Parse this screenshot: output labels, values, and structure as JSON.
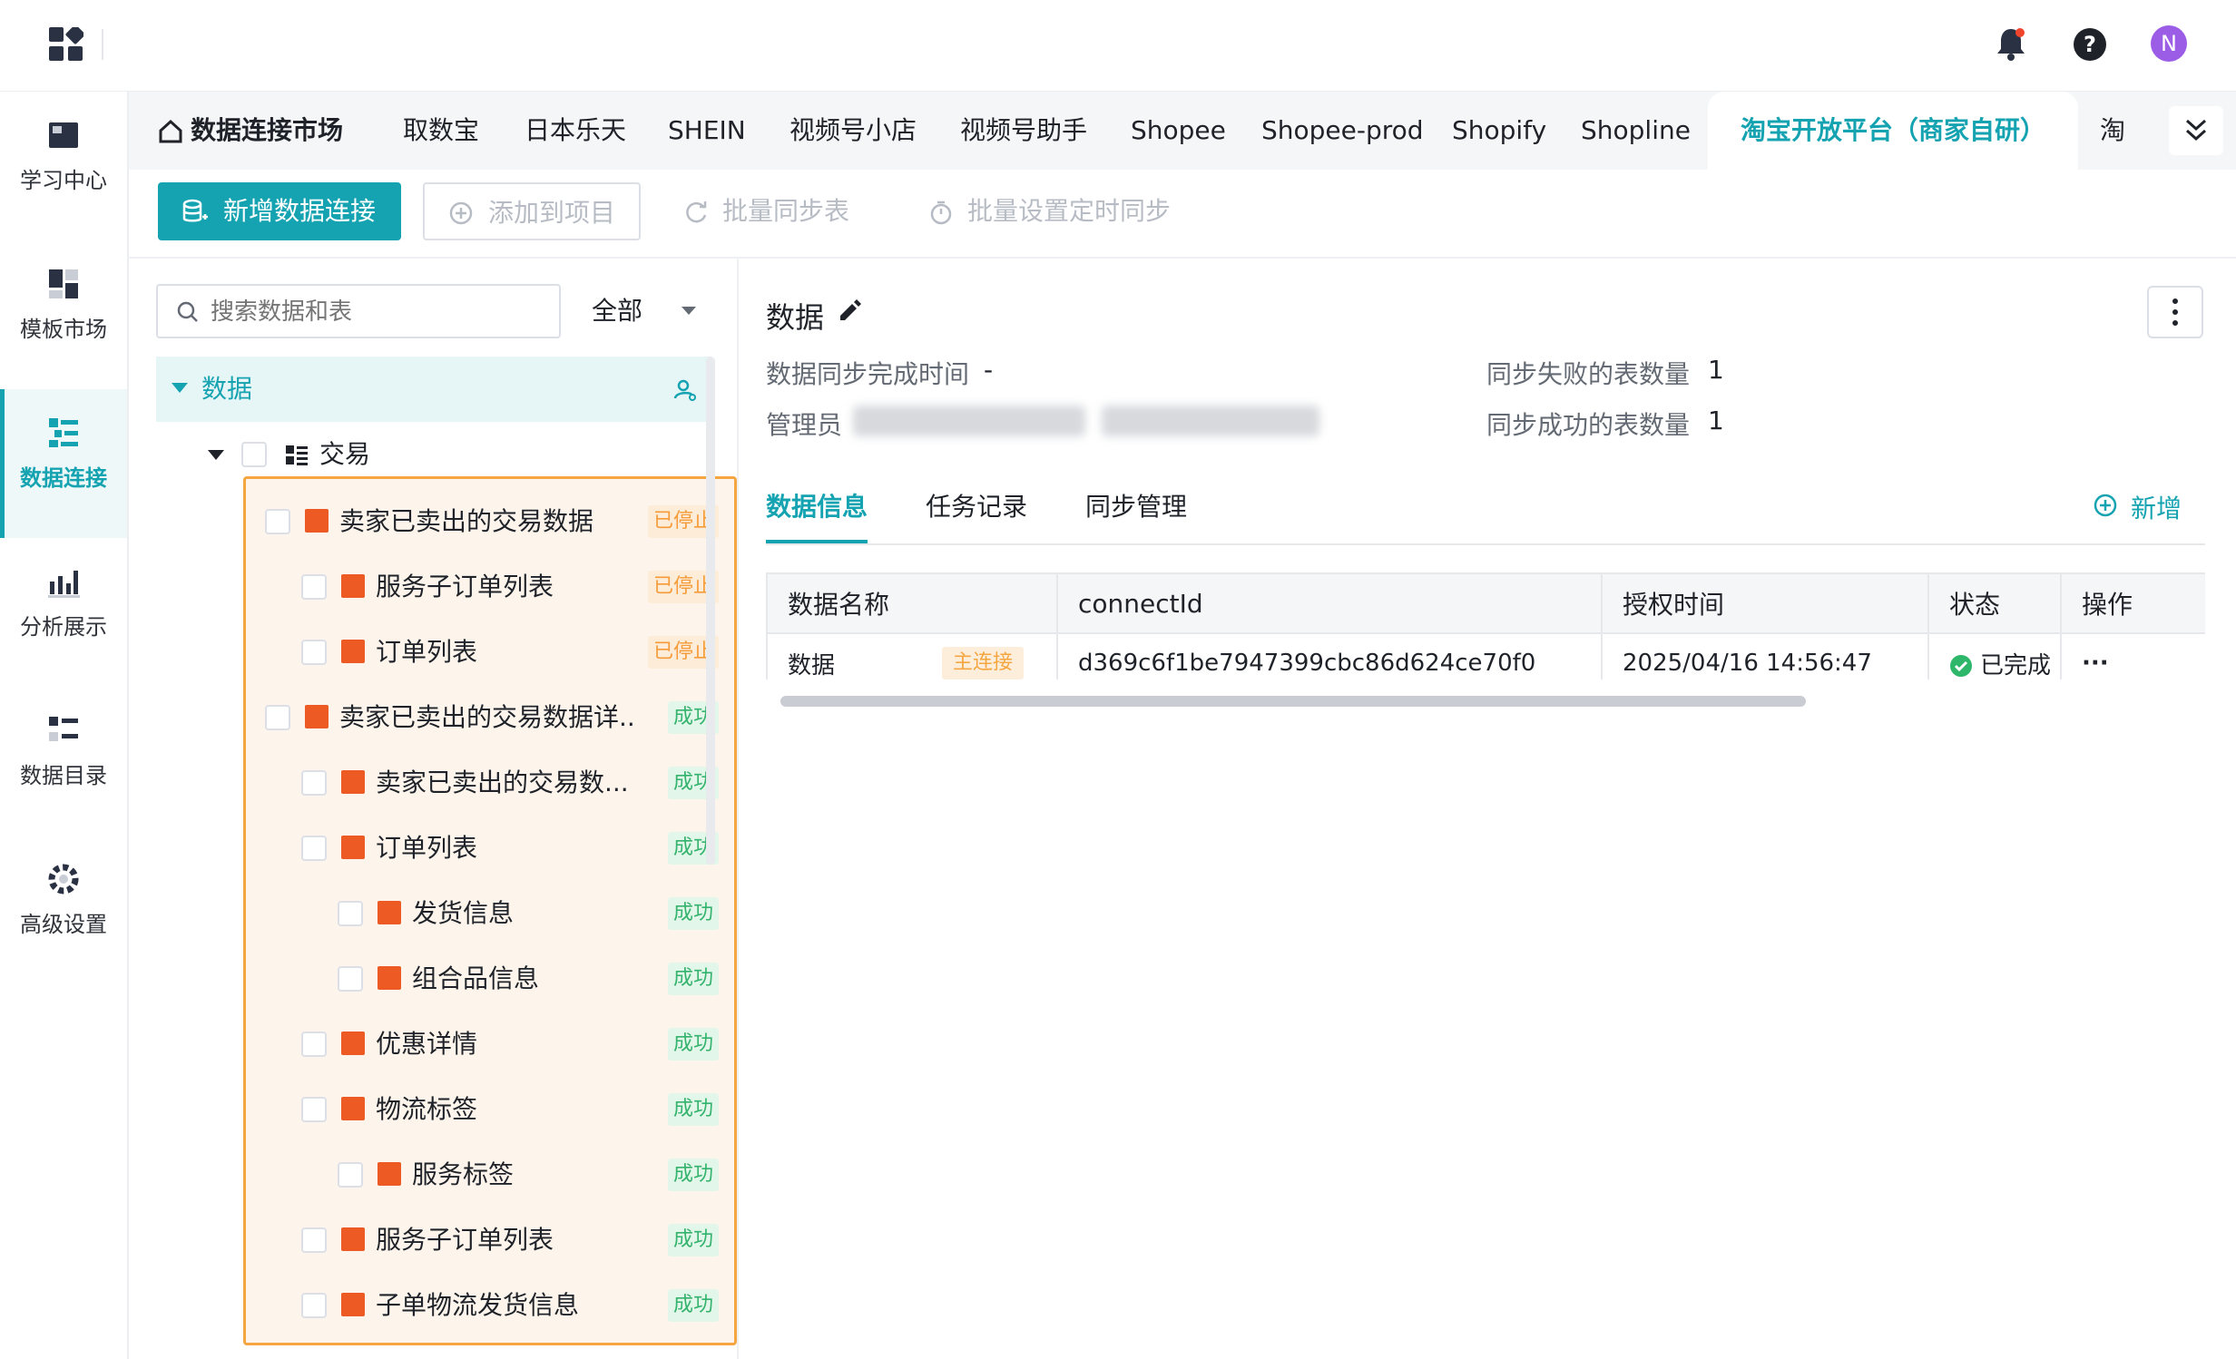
{
  "header": {
    "notification_icon": "bell-icon",
    "help_icon": "question-icon",
    "avatar_letter": "N",
    "avatar_color": "#9b5de5"
  },
  "rail": {
    "items": [
      {
        "label": "学习中心",
        "icon": "book-icon"
      },
      {
        "label": "模板市场",
        "icon": "template-icon"
      },
      {
        "label": "数据连接",
        "icon": "data-connect-icon"
      },
      {
        "label": "分析展示",
        "icon": "chart-icon"
      },
      {
        "label": "数据目录",
        "icon": "catalog-icon"
      },
      {
        "label": "高级设置",
        "icon": "gear-icon"
      }
    ]
  },
  "tabs": {
    "home_label": "数据连接市场",
    "items": [
      "取数宝",
      "日本乐天",
      "SHEIN",
      "视频号小店",
      "视频号助手",
      "Shopee",
      "Shopee-prod",
      "Shopify",
      "Shopline",
      "淘宝开放平台（商家自研）",
      "淘"
    ]
  },
  "toolbar": {
    "add_connection": "新增数据连接",
    "add_to_project": "添加到项目",
    "batch_sync": "批量同步表",
    "batch_schedule": "批量设置定时同步"
  },
  "tree": {
    "search_placeholder": "搜索数据和表",
    "filter_value": "全部",
    "root_label": "数据",
    "group_label": "交易",
    "items": [
      {
        "label": "卖家已卖出的交易数据",
        "status": "已停止",
        "ok": false
      },
      {
        "label": "服务子订单列表",
        "status": "已停止",
        "ok": false
      },
      {
        "label": "订单列表",
        "status": "已停止",
        "ok": false
      },
      {
        "label": "卖家已卖出的交易数据详...",
        "status": "成功",
        "ok": true
      },
      {
        "label": "卖家已卖出的交易数...",
        "status": "成功",
        "ok": true
      },
      {
        "label": "订单列表",
        "status": "成功",
        "ok": true
      },
      {
        "label": "发货信息",
        "status": "成功",
        "ok": true
      },
      {
        "label": "组合品信息",
        "status": "成功",
        "ok": true
      },
      {
        "label": "优惠详情",
        "status": "成功",
        "ok": true
      },
      {
        "label": "物流标签",
        "status": "成功",
        "ok": true
      },
      {
        "label": "服务标签",
        "status": "成功",
        "ok": true
      },
      {
        "label": "服务子订单列表",
        "status": "成功",
        "ok": true
      },
      {
        "label": "子单物流发货信息",
        "status": "成功",
        "ok": true
      }
    ],
    "highlight_color": "#f5a641"
  },
  "detail": {
    "title": "数据",
    "sync_time_label": "数据同步完成时间",
    "sync_time_value": "-",
    "admin_label": "管理员",
    "failed_label": "同步失败的表数量",
    "failed_value": "1",
    "success_label": "同步成功的表数量",
    "success_value": "1",
    "tabs": [
      "数据信息",
      "任务记录",
      "同步管理"
    ],
    "add_label": "新增",
    "table": {
      "headers": [
        "数据名称",
        "connectId",
        "授权时间",
        "状态",
        "操作"
      ],
      "rows": [
        {
          "name": "数据",
          "tag": "主连接",
          "connect_id": "d369c6f1be7947399cbc86d624ce70f0",
          "auth_time": "2025/04/16 14:56:47",
          "status": "已完成",
          "action": "···"
        }
      ]
    }
  },
  "accent_color": "#15a3b1"
}
